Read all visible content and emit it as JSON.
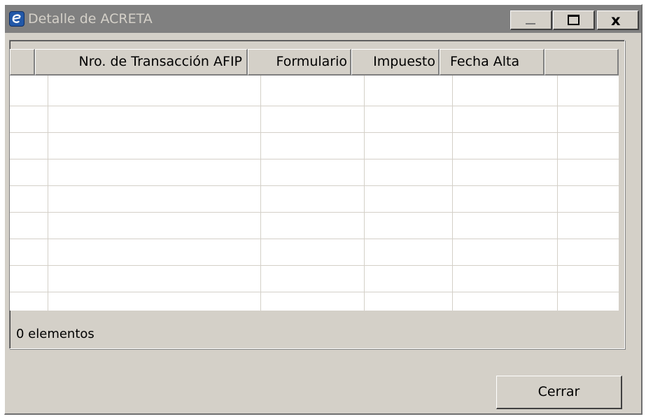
{
  "window": {
    "title": "Detalle de ACRETA",
    "icon": "app-e-icon",
    "controls": {
      "minimize_icon": "minimize-icon",
      "maximize_icon": "maximize-icon",
      "close_label": "x"
    }
  },
  "grid": {
    "columns": [
      {
        "key": "selector",
        "label": ""
      },
      {
        "key": "nro_transaccion",
        "label": "Nro. de Transacción AFIP"
      },
      {
        "key": "formulario",
        "label": "Formulario"
      },
      {
        "key": "impuesto",
        "label": "Impuesto"
      },
      {
        "key": "fecha_alta",
        "label": "Fecha Alta"
      },
      {
        "key": "filler",
        "label": ""
      }
    ],
    "rows": []
  },
  "status": {
    "count_text": "0 elementos"
  },
  "footer": {
    "close_button_label": "Cerrar"
  },
  "colors": {
    "window_bg": "#d4d0c8",
    "titlebar_bg": "#808080",
    "grid_bg": "#ffffff"
  }
}
